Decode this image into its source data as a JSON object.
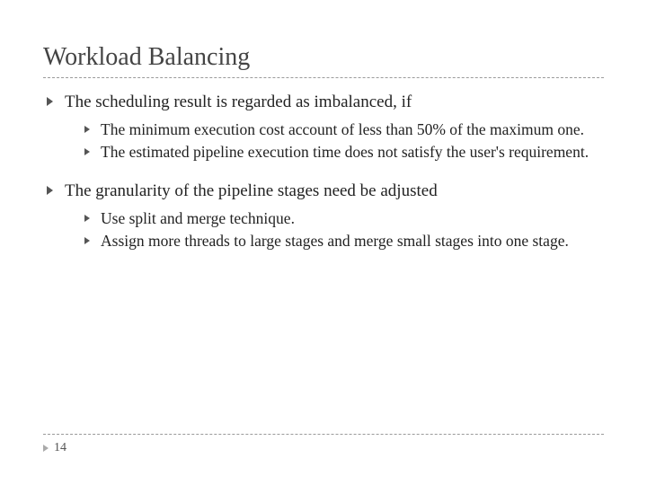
{
  "title": "Workload Balancing",
  "bullets": {
    "a": {
      "text": "The scheduling result is regarded as imbalanced, if",
      "sub": {
        "s1": "The minimum execution cost account of less than 50% of the maximum one.",
        "s2": "The estimated pipeline execution time does not satisfy the user's requirement."
      }
    },
    "b": {
      "text": "The granularity of the pipeline stages need be adjusted",
      "sub": {
        "s1": "Use split and merge technique.",
        "s2": "Assign more threads to large stages and merge small stages into one stage."
      }
    }
  },
  "page_number": "14"
}
